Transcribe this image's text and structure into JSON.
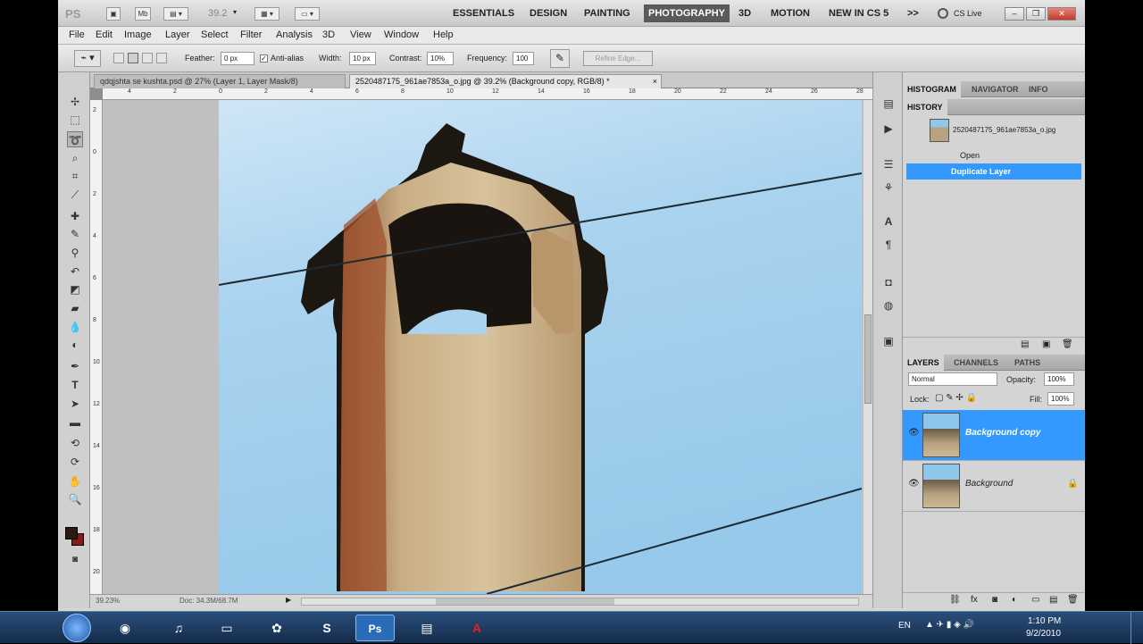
{
  "app_bar": {
    "logo": "PS",
    "mini_bridge": "Mb",
    "zoom_value": "39.2",
    "workspaces": [
      "ESSENTIALS",
      "DESIGN",
      "PAINTING",
      "PHOTOGRAPHY",
      "3D",
      "MOTION",
      "NEW IN CS 5"
    ],
    "active_workspace": "PHOTOGRAPHY",
    "more": ">>",
    "cs_live": "CS Live",
    "window_controls": [
      "minimize-icon",
      "restore-icon",
      "close-icon"
    ]
  },
  "menu": [
    "File",
    "Edit",
    "Image",
    "Layer",
    "Select",
    "Filter",
    "Analysis",
    "3D",
    "View",
    "Window",
    "Help"
  ],
  "options": {
    "feather_label": "Feather:",
    "feather_value": "0 px",
    "antialias_label": "Anti-alias",
    "width_label": "Width:",
    "width_value": "10 px",
    "contrast_label": "Contrast:",
    "contrast_value": "10%",
    "frequency_label": "Frequency:",
    "frequency_value": "100",
    "refine_edge": "Refine Edge..."
  },
  "tabs": [
    {
      "label": "qdqjshta se kushta.psd @ 27% (Layer 1, Layer Mask/8)",
      "active": false
    },
    {
      "label": "2520487175_961ae7853a_o.jpg @ 39.2% (Background copy, RGB/8) *",
      "active": true
    }
  ],
  "ruler_top": [
    "4",
    "2",
    "0",
    "2",
    "4",
    "6",
    "8",
    "10",
    "12",
    "14",
    "16",
    "18",
    "20",
    "22",
    "24",
    "26",
    "28"
  ],
  "ruler_left": [
    "2",
    "0",
    "2",
    "4",
    "6",
    "8",
    "10",
    "12",
    "14",
    "16",
    "18",
    "20"
  ],
  "status": {
    "zoom": "39.23%",
    "doc": "Doc: 34.3M/68.7M"
  },
  "panels": {
    "top_tabs": [
      "HISTOGRAM",
      "NAVIGATOR",
      "INFO"
    ],
    "history_title": "HISTORY",
    "snapshot": "2520487175_961ae7853a_o.jpg",
    "history_items": [
      {
        "label": "Open",
        "selected": false
      },
      {
        "label": "Duplicate Layer",
        "selected": true
      }
    ],
    "layers_tabs": [
      "LAYERS",
      "CHANNELS",
      "PATHS"
    ],
    "blend_mode": "Normal",
    "opacity_label": "Opacity:",
    "opacity_value": "100%",
    "lock_label": "Lock:",
    "fill_label": "Fill:",
    "fill_value": "100%",
    "layers": [
      {
        "name": "Background copy",
        "selected": true
      },
      {
        "name": "Background",
        "selected": false
      }
    ]
  },
  "taskbar": {
    "language": "EN",
    "time": "1:10 PM",
    "date": "9/2/2010"
  }
}
